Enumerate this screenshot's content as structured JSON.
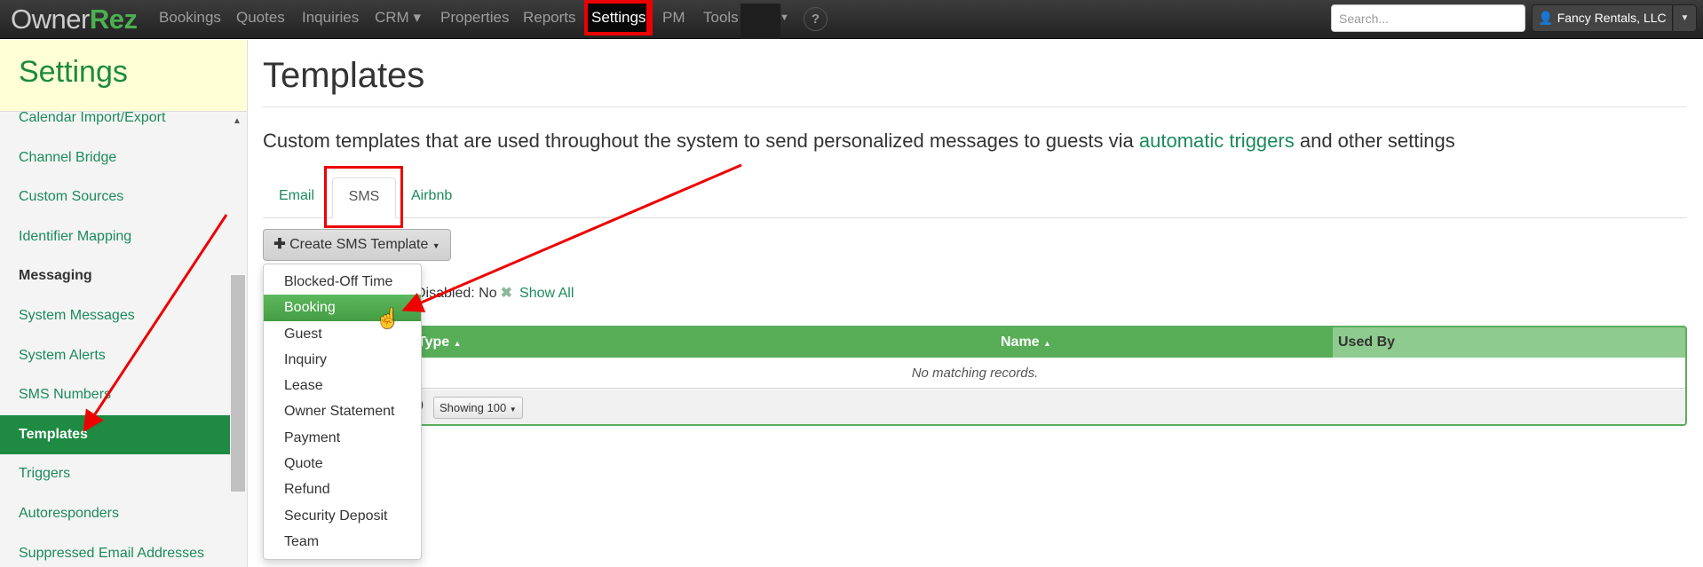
{
  "navbar": {
    "logo_left": "Owner",
    "logo_right": "Rez",
    "items": [
      "Bookings",
      "Quotes",
      "Inquiries",
      "CRM ▾",
      "Properties",
      "Reports",
      "Settings",
      "PM",
      "Tools"
    ],
    "active": "Settings",
    "help_label": "?",
    "search_placeholder": "Search...",
    "user_label": "Fancy Rentals, LLC"
  },
  "sidebar": {
    "title": "Settings",
    "items": [
      {
        "label": "Calendar Import/Export"
      },
      {
        "label": "Channel Bridge"
      },
      {
        "label": "Custom Sources"
      },
      {
        "label": "Identifier Mapping"
      },
      {
        "label": "Messaging",
        "group": true
      },
      {
        "label": "System Messages"
      },
      {
        "label": "System Alerts"
      },
      {
        "label": "SMS Numbers"
      },
      {
        "label": "Templates",
        "active": true
      },
      {
        "label": "Triggers"
      },
      {
        "label": "Autoresponders"
      },
      {
        "label": "Suppressed Email Addresses"
      }
    ]
  },
  "main": {
    "title": "Templates",
    "description_before": "Custom templates that are used throughout the system to send personalized messages to guests via ",
    "description_link": "automatic triggers",
    "description_after": " and other settings",
    "tabs": [
      {
        "label": "Email"
      },
      {
        "label": "SMS",
        "active": true
      },
      {
        "label": "Airbnb"
      }
    ],
    "create_button": "Create SMS Template",
    "dropdown_items": [
      "Blocked-Off Time",
      "Booking",
      "Guest",
      "Inquiry",
      "Lease",
      "Owner Statement",
      "Payment",
      "Quote",
      "Refund",
      "Security Deposit",
      "Team"
    ],
    "dropdown_highlighted": "Booking",
    "filter": {
      "label": "Disabled: No",
      "show_all": "Show All"
    },
    "table": {
      "columns": [
        "Type",
        "Name",
        "Used By"
      ],
      "sort_indicator": "▲",
      "empty_message": "No matching records.",
      "footer_count": "0",
      "page_size_label": "Showing 100"
    }
  },
  "colors": {
    "brand_green": "#4caf50",
    "link_green": "#1b8a5a",
    "active_sidebar": "#1e8a42",
    "table_header": "#57ae57",
    "annotation_red": "#ee0000"
  }
}
